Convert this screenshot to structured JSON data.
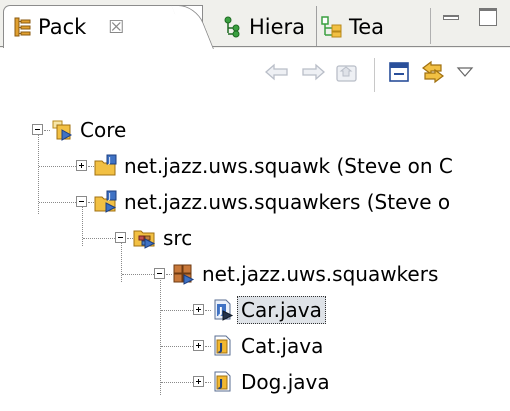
{
  "tabs": [
    {
      "label": "Pack",
      "close": "☒"
    },
    {
      "label": "Hiera"
    },
    {
      "label": "Tea"
    }
  ],
  "tree": {
    "rows": [
      {
        "label": "Core"
      },
      {
        "label": "net.jazz.uws.squawk (Steve on C"
      },
      {
        "label": "net.jazz.uws.squawkers (Steve o"
      },
      {
        "label": "src"
      },
      {
        "label": "net.jazz.uws.squawkers"
      },
      {
        "label": "Car.java"
      },
      {
        "label": "Cat.java"
      },
      {
        "label": "Dog.java"
      }
    ]
  },
  "colors": {
    "tab_strip": "#f0f0ec",
    "folder_yellow": "#f2c043",
    "java_blue": "#3f72c4",
    "arrow_yellow": "#e8a920",
    "selection": "#dfe3e8"
  }
}
